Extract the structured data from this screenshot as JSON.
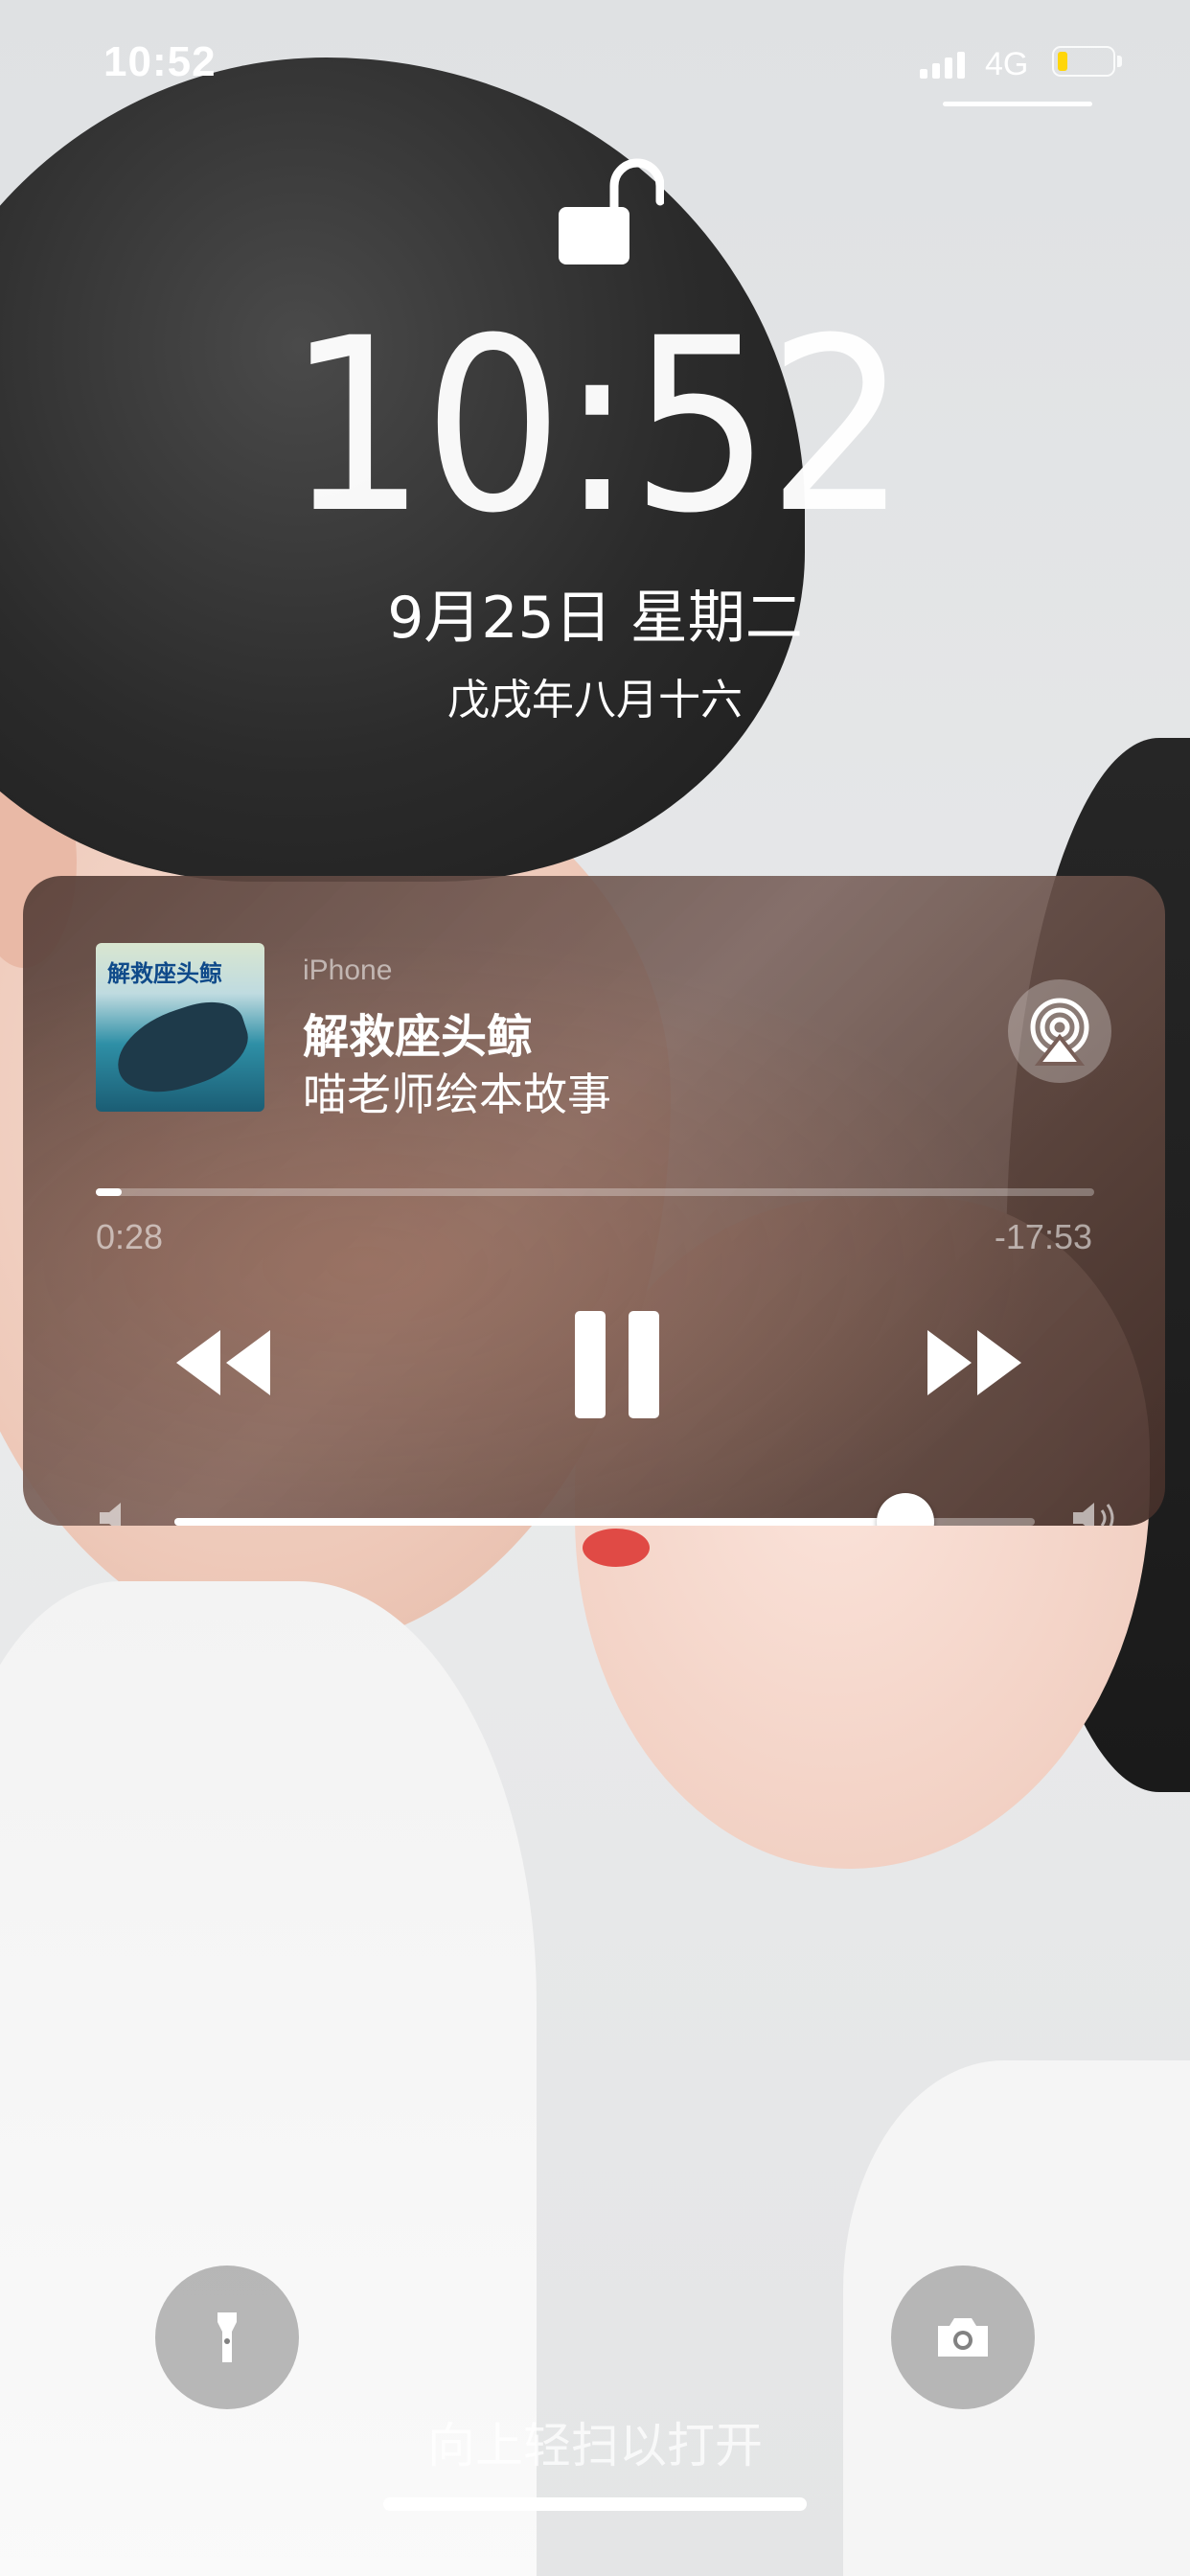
{
  "status_bar": {
    "time": "10:52",
    "network": "4G",
    "battery_color": "#ffd60a"
  },
  "lock_screen": {
    "lock_icon": "unlocked-padlock-icon",
    "time": "10:52",
    "date": "9月25日 星期二",
    "lunar_date": "戊戌年八月十六"
  },
  "now_playing": {
    "source": "iPhone",
    "title": "解救座头鲸",
    "artist": "喵老师绘本故事",
    "album_art_title": "解救座头鲸",
    "elapsed": "0:28",
    "remaining": "-17:53",
    "progress_fraction": 0.026,
    "volume_fraction": 0.85,
    "icons": {
      "airplay": "airplay-icon",
      "rewind": "rewind-icon",
      "pause": "pause-icon",
      "forward": "fast-forward-icon",
      "volume_min": "speaker-low-icon",
      "volume_max": "speaker-high-icon"
    }
  },
  "bottom": {
    "flashlight_icon": "flashlight-icon",
    "camera_icon": "camera-icon",
    "swipe_hint": "向上轻扫以打开"
  }
}
